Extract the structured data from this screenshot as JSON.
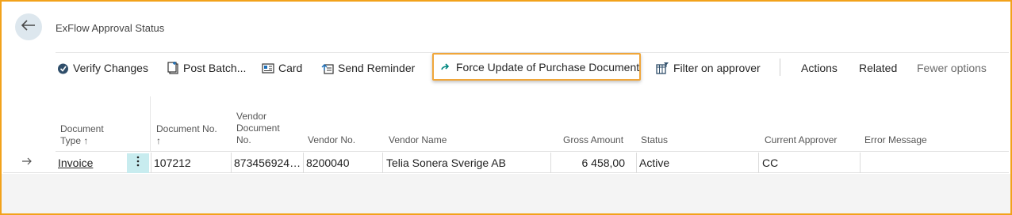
{
  "page": {
    "title": "ExFlow Approval Status"
  },
  "toolbar": {
    "verify_changes": "Verify Changes",
    "post_batch": "Post Batch...",
    "card": "Card",
    "send_reminder": "Send Reminder",
    "force_update": "Force Update of Purchase Document",
    "filter_on_approver": "Filter on approver",
    "actions": "Actions",
    "related": "Related",
    "fewer_options": "Fewer options"
  },
  "columns": {
    "document_type": [
      "Document",
      "Type"
    ],
    "document_no": [
      "Document No."
    ],
    "vendor_document_no": [
      "Vendor",
      "Document",
      "No."
    ],
    "vendor_no": "Vendor No.",
    "vendor_name": "Vendor Name",
    "gross_amount": "Gross Amount",
    "status": "Status",
    "current_approver": "Current Approver",
    "error_message": "Error Message",
    "sort_indicator": "↑"
  },
  "rows": [
    {
      "document_type": "Invoice",
      "document_no": "107212",
      "vendor_document_no": "873456924…",
      "vendor_no": "8200040",
      "vendor_name": "Telia Sonera Sverige AB",
      "gross_amount": "6 458,00",
      "status": "Active",
      "current_approver": "CC",
      "error_message": ""
    }
  ],
  "colors": {
    "highlight_border": "#f0a63a",
    "frame_border": "#f2a21b",
    "selected_cell": "#c8ecef",
    "accent": "#00867f"
  }
}
